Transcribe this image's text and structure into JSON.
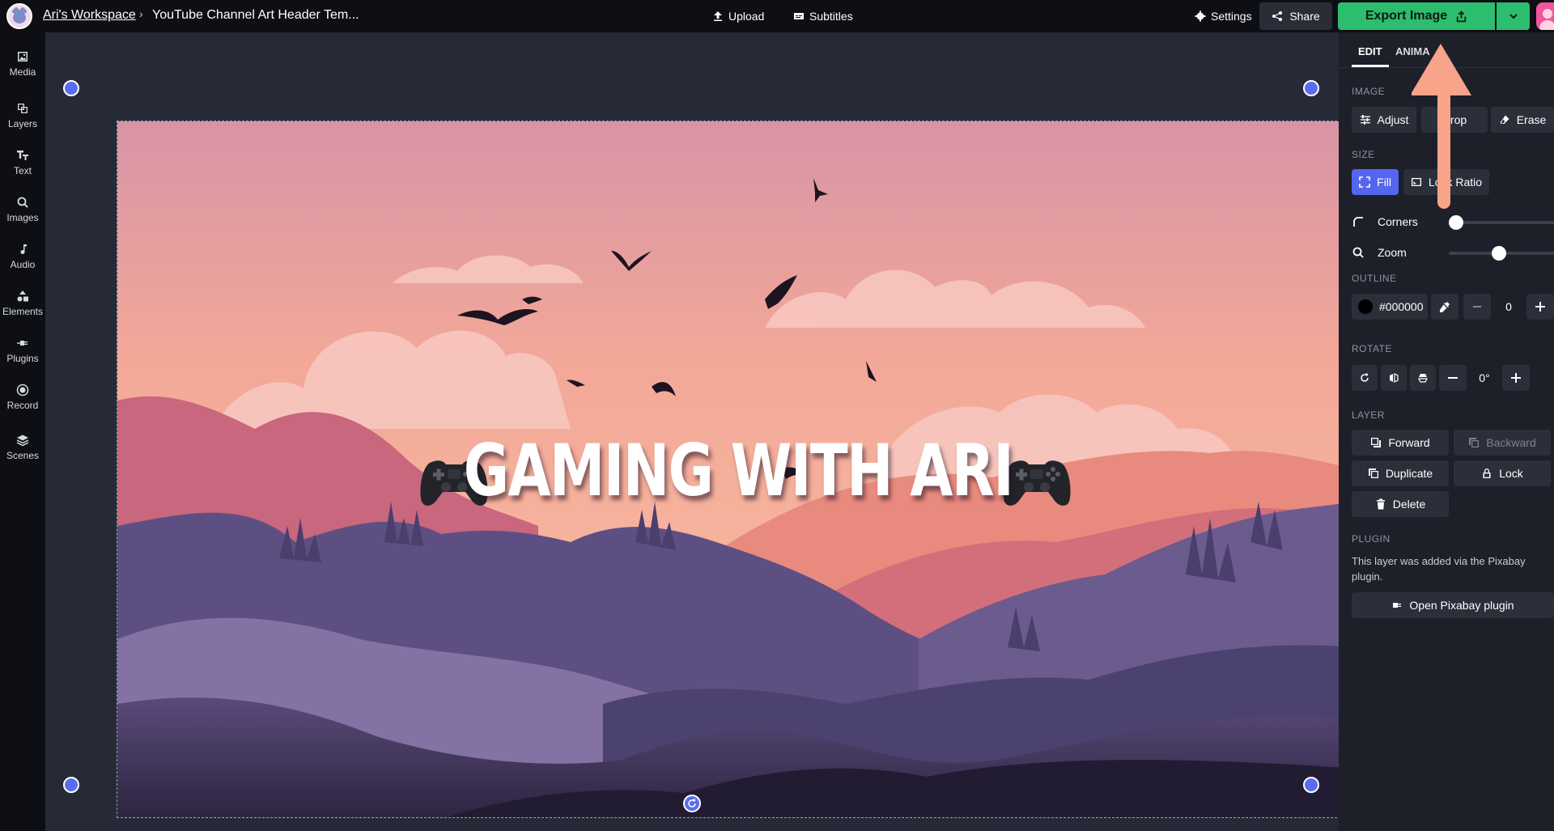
{
  "topbar": {
    "workspace": "Ari's Workspace",
    "separator": "›",
    "project_title": "YouTube Channel Art Header Tem...",
    "upload_label": "Upload",
    "subtitles_label": "Subtitles",
    "settings_label": "Settings",
    "share_label": "Share",
    "export_label": "Export Image"
  },
  "sidebar": {
    "items": [
      {
        "label": "Media",
        "icon": "image-icon"
      },
      {
        "label": "Layers",
        "icon": "layers-icon"
      },
      {
        "label": "Text",
        "icon": "text-icon"
      },
      {
        "label": "Images",
        "icon": "search-icon"
      },
      {
        "label": "Audio",
        "icon": "music-note-icon"
      },
      {
        "label": "Elements",
        "icon": "shapes-icon"
      },
      {
        "label": "Plugins",
        "icon": "plug-icon"
      },
      {
        "label": "Record",
        "icon": "record-icon"
      },
      {
        "label": "Scenes",
        "icon": "stack-icon"
      }
    ]
  },
  "canvas": {
    "headline": "GAMING WITH ARI"
  },
  "panel": {
    "tabs": {
      "edit": "EDIT",
      "animate": "ANIMA"
    },
    "image": {
      "label": "IMAGE",
      "adjust": "Adjust",
      "crop": "Crop",
      "erase": "Erase"
    },
    "size": {
      "label": "SIZE",
      "fill": "Fill",
      "lock_ratio": "Lock Ratio"
    },
    "corners": {
      "label": "Corners",
      "value": 0.0
    },
    "zoom": {
      "label": "Zoom",
      "value": 0.4
    },
    "outline": {
      "label": "OUTLINE",
      "color": "#000000",
      "width": "0"
    },
    "rotate": {
      "label": "ROTATE",
      "angle": "0°"
    },
    "layer": {
      "label": "LAYER",
      "forward": "Forward",
      "backward": "Backward",
      "duplicate": "Duplicate",
      "lock": "Lock",
      "delete": "Delete"
    },
    "plugin": {
      "label": "PLUGIN",
      "note": "This layer was added via the Pixabay plugin.",
      "open": "Open Pixabay plugin"
    }
  },
  "colors": {
    "accent": "#5466f0",
    "export_green": "#2dbd6e",
    "annotation_arrow": "#f7a48a"
  }
}
